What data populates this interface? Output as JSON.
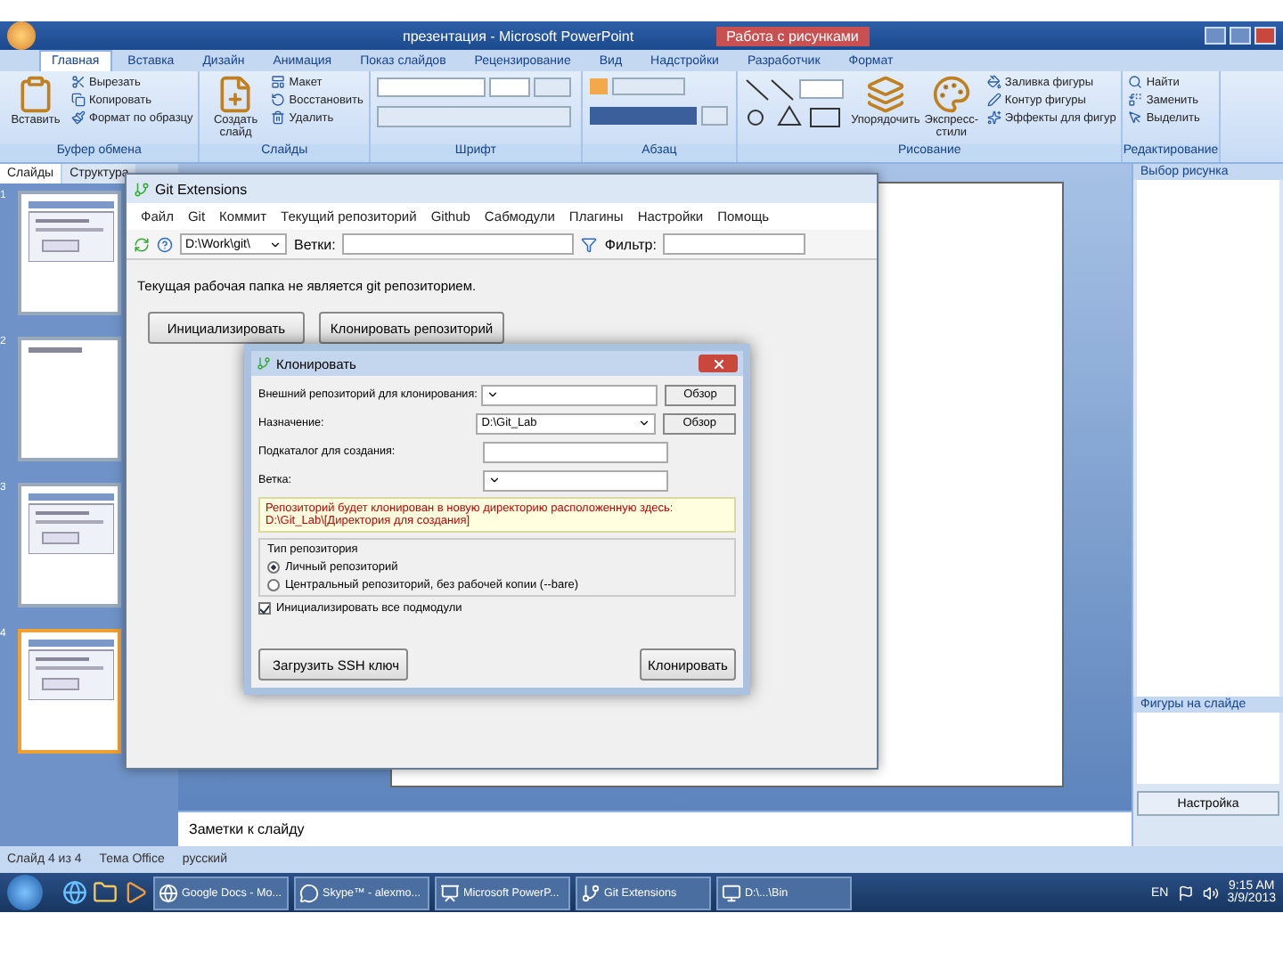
{
  "ppt": {
    "title": "презентация - Microsoft PowerPoint",
    "context_tab": "Работа с рисунками",
    "tabs": [
      {
        "label": "Главная",
        "selected": true
      },
      {
        "label": "Вставка",
        "selected": false
      },
      {
        "label": "Дизайн",
        "selected": false
      },
      {
        "label": "Анимация",
        "selected": false
      },
      {
        "label": "Показ слайдов",
        "selected": false
      },
      {
        "label": "Рецензирование",
        "selected": false
      },
      {
        "label": "Вид",
        "selected": false
      },
      {
        "label": "Надстройки",
        "selected": false
      },
      {
        "label": "Разработчик",
        "selected": false
      },
      {
        "label": "Формат",
        "selected": false
      }
    ],
    "groups": [
      {
        "label": "Буфер обмена",
        "items": [
          {
            "label": "Вставить",
            "kind": "large"
          },
          {
            "label": "Вырезать",
            "kind": "small"
          },
          {
            "label": "Копировать",
            "kind": "small"
          },
          {
            "label": "Формат по образцу",
            "kind": "small"
          }
        ]
      },
      {
        "label": "Слайды",
        "items": [
          {
            "label": "Создать слайд",
            "kind": "large"
          },
          {
            "label": "Макет",
            "kind": "small"
          },
          {
            "label": "Восстановить",
            "kind": "small"
          },
          {
            "label": "Удалить",
            "kind": "small"
          }
        ]
      },
      {
        "label": "Шрифт",
        "items": [
          {
            "kind": "font"
          }
        ]
      },
      {
        "label": "Абзац",
        "items": [
          {
            "kind": "paragraph"
          }
        ]
      },
      {
        "label": "Рисование",
        "items": [
          {
            "kind": "shapes"
          },
          {
            "label": "Упорядочить",
            "kind": "large"
          },
          {
            "label": "Экспресс-стили",
            "kind": "large"
          },
          {
            "label": "Заливка фигуры",
            "kind": "small"
          },
          {
            "label": "Контур фигуры",
            "kind": "small"
          },
          {
            "label": "Эффекты для фигур",
            "kind": "small"
          }
        ]
      },
      {
        "label": "Редактирование",
        "items": [
          {
            "label": "Найти",
            "kind": "small"
          },
          {
            "label": "Заменить",
            "kind": "small"
          },
          {
            "label": "Выделить",
            "kind": "small"
          }
        ]
      }
    ],
    "side_tabs": [
      {
        "label": "Слайды",
        "selected": true
      },
      {
        "label": "Структура",
        "selected": false
      }
    ],
    "slides": [
      {
        "number": "1",
        "selected": false
      },
      {
        "number": "2",
        "selected": false
      },
      {
        "number": "3",
        "selected": false
      },
      {
        "number": "4",
        "selected": true
      }
    ],
    "right_panel": {
      "title": "Выбор рисунка",
      "section": "Фигуры на слайде",
      "button": "Настройка"
    },
    "notes": "Заметки к слайду",
    "status": [
      "Слайд 4 из 4",
      "Тема Office",
      "русский"
    ]
  },
  "git": {
    "title": "Git Extensions",
    "menu": [
      "Файл",
      "Git",
      "Коммит",
      "Текущий репозиторий",
      "Github",
      "Сабмодули",
      "Плагины",
      "Настройки",
      "Помощь"
    ],
    "path": "D:\\Work\\git\\",
    "branches": "Ветки:",
    "filter": "Фильтр:",
    "message": "Текущая рабочая папка не является git репозиторием.",
    "buttons": [
      "Инициализировать",
      "Клонировать репозиторий"
    ]
  },
  "dialog": {
    "title": "Клонировать",
    "fields": [
      {
        "label": "Внешний репозиторий для клонирования:",
        "kind": "combo",
        "browse": "Обзор"
      },
      {
        "label": "Назначение:",
        "value": "D:\\Git_Lab",
        "kind": "combo",
        "browse": "Обзор"
      },
      {
        "label": "Подкаталог для создания:",
        "kind": "text"
      },
      {
        "label": "Ветка:",
        "kind": "combo"
      }
    ],
    "info": [
      "Репозиторий будет клонирован в новую директорию расположенную здесь:",
      "D:\\Git_Lab\\[Директория для создания]"
    ],
    "group_title": "Тип репозитория",
    "options": [
      {
        "label": "Личный репозиторий",
        "selected": true
      },
      {
        "label": "Центральный репозиторий, без рабочей копии (--bare)",
        "selected": false
      }
    ],
    "checkbox": {
      "label": "Инициализировать все подмодули",
      "checked": true
    },
    "ssh_button": "Загрузить SSH ключ",
    "ok_button": "Клонировать"
  },
  "taskbar": {
    "items": [
      {
        "label": "Google Docs - Mo..."
      },
      {
        "label": "Skype™ - alexmo..."
      },
      {
        "label": "Microsoft PowerP..."
      },
      {
        "label": "Git Extensions"
      },
      {
        "label": "D:\\...\\Bin"
      }
    ],
    "lang": "EN",
    "time": "9:15 AM",
    "date": "3/9/2013"
  }
}
